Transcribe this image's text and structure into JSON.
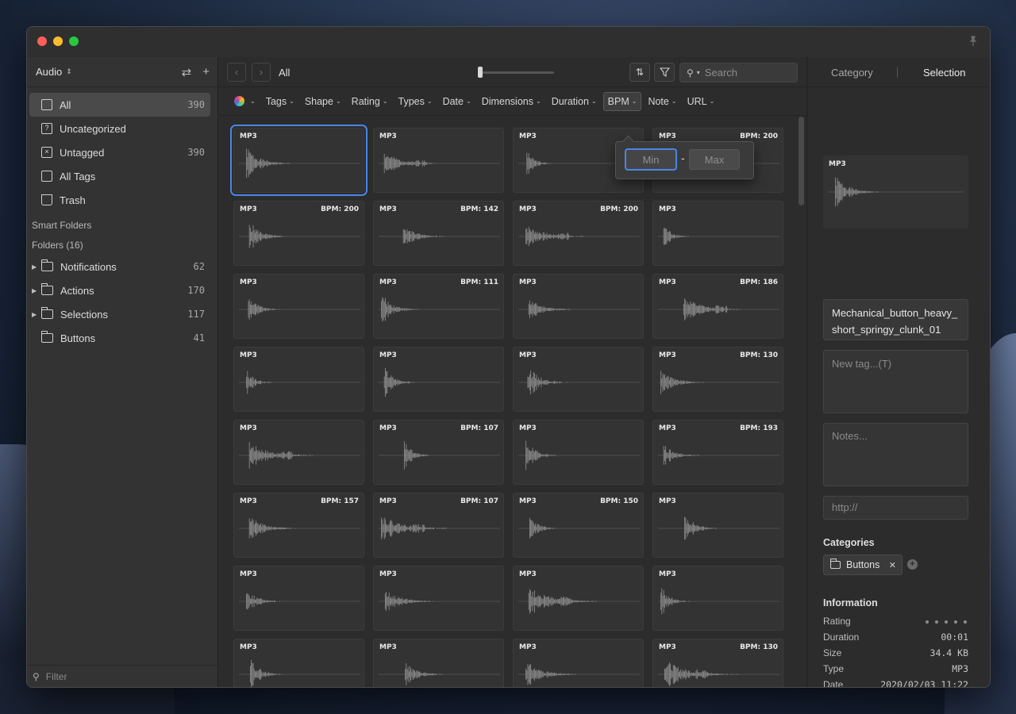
{
  "sidebar": {
    "library": "Audio",
    "items": [
      {
        "label": "All",
        "count": "390",
        "icon": "archive-icon"
      },
      {
        "label": "Uncategorized",
        "count": "",
        "icon": "question-icon"
      },
      {
        "label": "Untagged",
        "count": "390",
        "icon": "untagged-icon"
      },
      {
        "label": "All Tags",
        "count": "",
        "icon": "tag-icon"
      },
      {
        "label": "Trash",
        "count": "",
        "icon": "trash-icon"
      }
    ],
    "smart_folders": "Smart Folders",
    "folders_header": "Folders (16)",
    "folders": [
      {
        "label": "Notifications",
        "count": "62"
      },
      {
        "label": "Actions",
        "count": "170"
      },
      {
        "label": "Selections",
        "count": "117"
      },
      {
        "label": "Buttons",
        "count": "41"
      }
    ],
    "filter_placeholder": "Filter"
  },
  "toolbar": {
    "crumb": "All",
    "search_placeholder": "Search"
  },
  "filterbar": [
    "Tags",
    "Shape",
    "Rating",
    "Types",
    "Date",
    "Dimensions",
    "Duration",
    "BPM",
    "Note",
    "URL"
  ],
  "bpm_popup": {
    "min": "Min",
    "max": "Max",
    "dash": "-"
  },
  "tiles": [
    {
      "fmt": "MP3",
      "bpm": ""
    },
    {
      "fmt": "MP3",
      "bpm": ""
    },
    {
      "fmt": "MP3",
      "bpm": ""
    },
    {
      "fmt": "MP3",
      "bpm": "BPM: 200"
    },
    {
      "fmt": "MP3",
      "bpm": "BPM: 200"
    },
    {
      "fmt": "MP3",
      "bpm": "BPM: 142"
    },
    {
      "fmt": "MP3",
      "bpm": "BPM: 200"
    },
    {
      "fmt": "MP3",
      "bpm": ""
    },
    {
      "fmt": "MP3",
      "bpm": ""
    },
    {
      "fmt": "MP3",
      "bpm": "BPM: 111"
    },
    {
      "fmt": "MP3",
      "bpm": ""
    },
    {
      "fmt": "MP3",
      "bpm": "BPM: 186"
    },
    {
      "fmt": "MP3",
      "bpm": ""
    },
    {
      "fmt": "MP3",
      "bpm": ""
    },
    {
      "fmt": "MP3",
      "bpm": ""
    },
    {
      "fmt": "MP3",
      "bpm": "BPM: 130"
    },
    {
      "fmt": "MP3",
      "bpm": ""
    },
    {
      "fmt": "MP3",
      "bpm": "BPM: 107"
    },
    {
      "fmt": "MP3",
      "bpm": ""
    },
    {
      "fmt": "MP3",
      "bpm": "BPM: 193"
    },
    {
      "fmt": "MP3",
      "bpm": "BPM: 157"
    },
    {
      "fmt": "MP3",
      "bpm": "BPM: 107"
    },
    {
      "fmt": "MP3",
      "bpm": "BPM: 150"
    },
    {
      "fmt": "MP3",
      "bpm": ""
    },
    {
      "fmt": "MP3",
      "bpm": ""
    },
    {
      "fmt": "MP3",
      "bpm": ""
    },
    {
      "fmt": "MP3",
      "bpm": ""
    },
    {
      "fmt": "MP3",
      "bpm": ""
    },
    {
      "fmt": "MP3",
      "bpm": ""
    },
    {
      "fmt": "MP3",
      "bpm": ""
    },
    {
      "fmt": "MP3",
      "bpm": ""
    },
    {
      "fmt": "MP3",
      "bpm": "BPM: 130"
    }
  ],
  "inspector": {
    "tab_category": "Category",
    "tab_selection": "Selection",
    "preview_fmt": "MP3",
    "filename": "Mechanical_button_heavy_short_springy_clunk_01",
    "tag_placeholder": "New tag...(T)",
    "notes_placeholder": "Notes...",
    "url_placeholder": "http://",
    "categories_title": "Categories",
    "category": "Buttons",
    "information_title": "Information",
    "info": {
      "rating_label": "Rating",
      "duration_label": "Duration",
      "duration": "00:01",
      "size_label": "Size",
      "size": "34.4 KB",
      "type_label": "Type",
      "type": "MP3",
      "date_label": "Date",
      "date": "2020/02/03 11:22"
    }
  },
  "colors": {
    "accent": "#4a86e8",
    "window_bg": "#2e2e2e"
  }
}
